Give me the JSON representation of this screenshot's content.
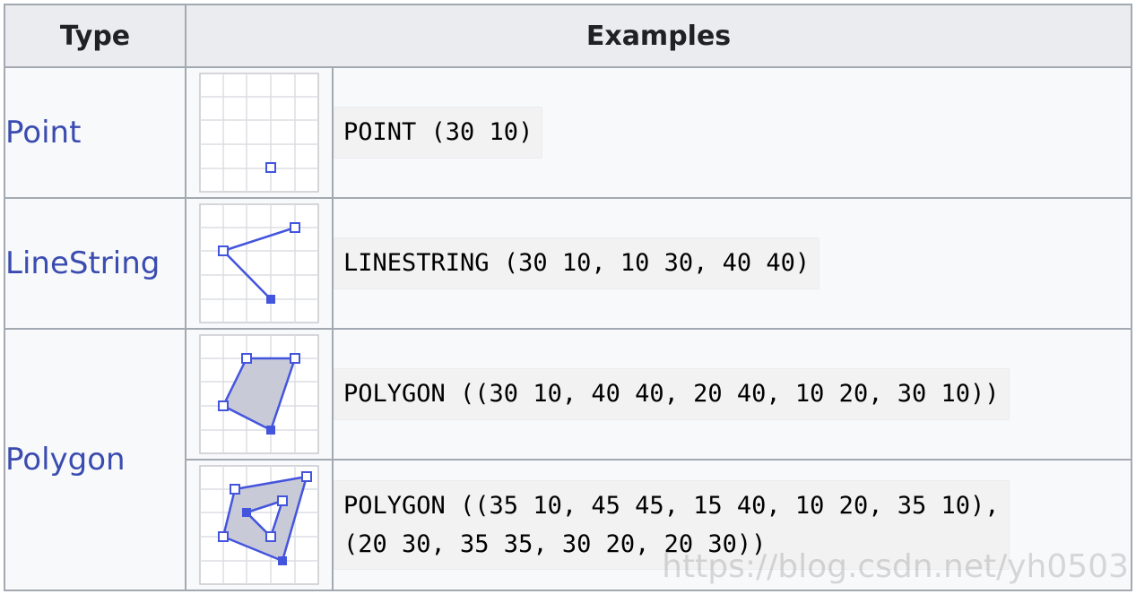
{
  "table": {
    "headers": {
      "type": "Type",
      "examples": "Examples"
    },
    "rows": [
      {
        "type": "Point",
        "examples": [
          "POINT (30 10)"
        ]
      },
      {
        "type": "LineString",
        "examples": [
          "LINESTRING (30 10, 10 30, 40 40)"
        ]
      },
      {
        "type": "Polygon",
        "examples": [
          "POLYGON ((30 10, 40 40, 20 40, 10 20, 30 10))",
          "POLYGON ((35 10, 45 45, 15 40, 10 20, 35 10),\n(20 30, 35 35, 30 20, 20 30))"
        ]
      }
    ]
  },
  "colors": {
    "geometry_stroke": "#4455dd",
    "polygon_fill": "#c8cad8",
    "grid_line": "#dcdde3",
    "link_text": "#3b4cb0",
    "header_bg": "#eaecf0",
    "border": "#a2a9b1"
  },
  "watermark": "https://blog.csdn.net/yh0503"
}
